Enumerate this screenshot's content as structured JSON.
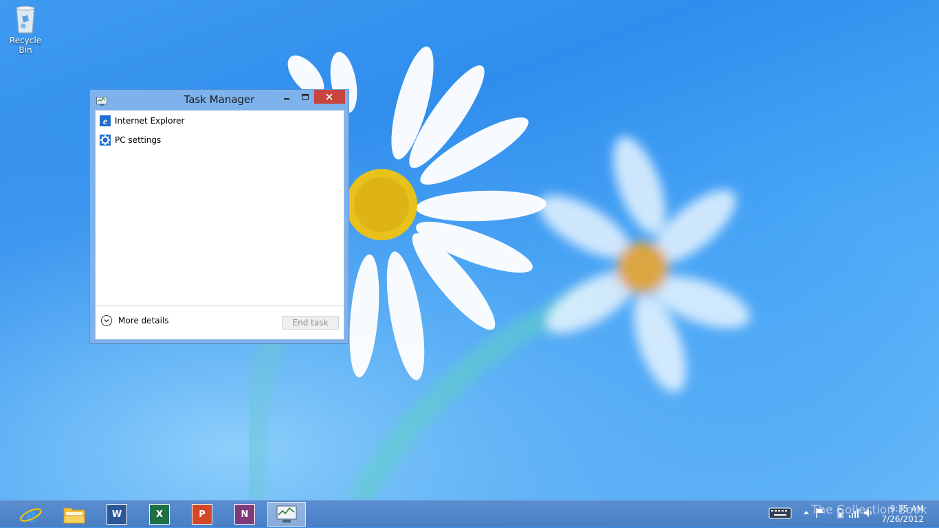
{
  "desktop": {
    "icons": [
      {
        "label": "Recycle Bin",
        "icon": "recycle-bin-icon"
      }
    ]
  },
  "task_manager": {
    "title": "Task Manager",
    "processes": [
      {
        "name": "Internet Explorer",
        "icon": "internet-explorer-icon"
      },
      {
        "name": "PC settings",
        "icon": "pc-settings-gear-icon"
      }
    ],
    "more_details_label": "More details",
    "end_task_label": "End task",
    "colors": {
      "close_button": "#c7443f",
      "frame": "#7db2ec"
    }
  },
  "taskbar": {
    "apps": [
      {
        "name": "internet-explorer",
        "icon": "ie-icon"
      },
      {
        "name": "file-explorer",
        "icon": "folder-icon"
      },
      {
        "name": "word",
        "icon": "word-icon",
        "letter": "W",
        "color": "#2b5797"
      },
      {
        "name": "excel",
        "icon": "excel-icon",
        "letter": "X",
        "color": "#1e7145"
      },
      {
        "name": "powerpoint",
        "icon": "powerpoint-icon",
        "letter": "P",
        "color": "#d24726"
      },
      {
        "name": "onenote",
        "icon": "onenote-icon",
        "letter": "N",
        "color": "#80397b"
      },
      {
        "name": "task-manager",
        "icon": "task-manager-icon",
        "active": true
      }
    ],
    "watermark": "The Collection Book",
    "clock": {
      "time": "9:35 AM",
      "date": "7/26/2012"
    }
  }
}
